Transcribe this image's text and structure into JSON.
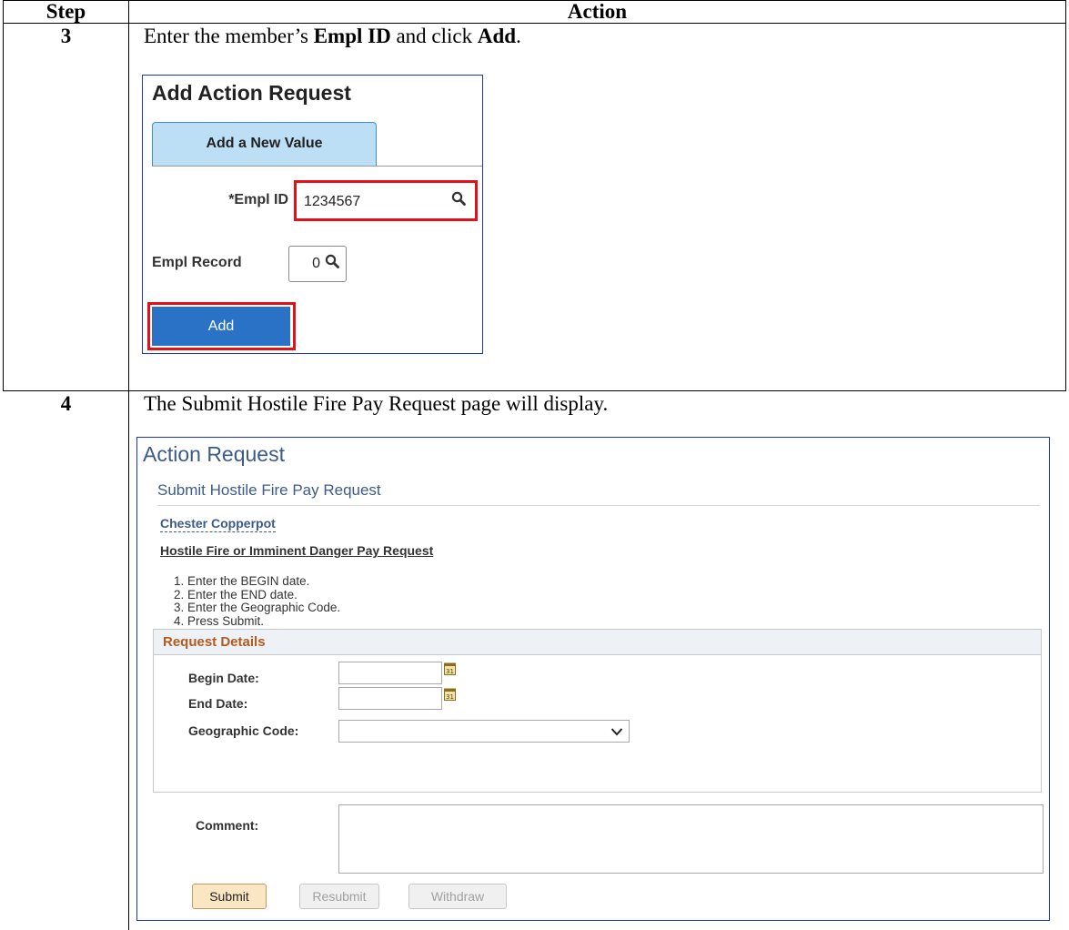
{
  "table": {
    "header_step": "Step",
    "header_action": "Action"
  },
  "step3": {
    "number": "3",
    "text_before": "Enter the member’s ",
    "bold1": "Empl ID",
    "text_mid": " and click ",
    "bold2": "Add",
    "text_after": ".",
    "screen": {
      "title": "Add Action Request",
      "tab_label": "Add a New Value",
      "emplid_label": "*Empl ID",
      "emplid_value": "1234567",
      "emplrecord_label": "Empl Record",
      "emplrecord_value": "0",
      "add_button": "Add",
      "highlight_color": "#e3101a",
      "button_color": "#2a72c6",
      "icons": [
        "search-icon",
        "search-icon"
      ]
    }
  },
  "step4": {
    "number": "4",
    "text": "The Submit Hostile Fire Pay Request page will display.",
    "screen": {
      "title": "Action Request",
      "subtitle": "Submit Hostile Fire Pay Request",
      "member_name": "Chester Copperpot",
      "section_heading": "Hostile Fire or Imminent Danger Pay Request",
      "instructions": [
        "1.  Enter the BEGIN date.",
        "2.  Enter the END date.",
        "3.  Enter the Geographic Code.",
        "4.  Press Submit."
      ],
      "details_heading": "Request Details",
      "begin_date_label": "Begin Date:",
      "begin_date_value": "",
      "end_date_label": "End Date:",
      "end_date_value": "",
      "geo_code_label": "Geographic Code:",
      "geo_code_value": "",
      "comment_label": "Comment:",
      "comment_value": "",
      "submit_button": "Submit",
      "resubmit_button": "Resubmit",
      "withdraw_button": "Withdraw",
      "accent_color": "#3d5b8a",
      "section_color": "#b35a1f",
      "icons": [
        "calendar-icon",
        "calendar-icon",
        "chevron-down-icon"
      ]
    }
  }
}
